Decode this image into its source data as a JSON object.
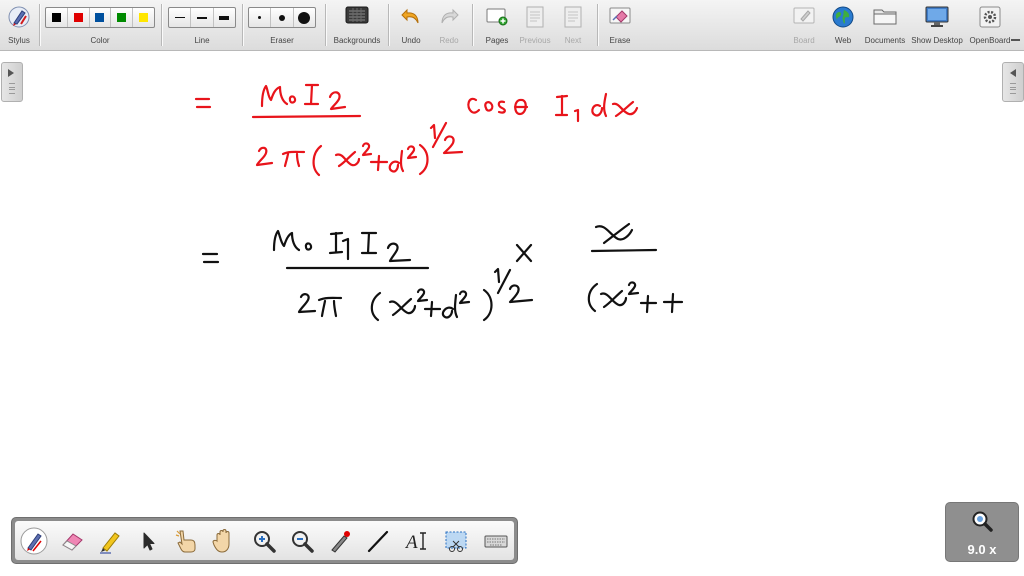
{
  "toolbar": {
    "stylus": "Stylus",
    "color": "Color",
    "line": "Line",
    "eraser": "Eraser",
    "backgrounds": "Backgrounds",
    "undo": "Undo",
    "redo": "Redo",
    "pages": "Pages",
    "previous": "Previous",
    "next": "Next",
    "erase": "Erase",
    "board": "Board",
    "web": "Web",
    "documents": "Documents",
    "show_desktop": "Show Desktop",
    "openboard": "OpenBoard"
  },
  "colors": [
    "#000000",
    "#e00000",
    "#00509e",
    "#008a00",
    "#ffe600"
  ],
  "ink_color": "#e8141b",
  "ink_color_2": "#111111",
  "zoom": {
    "value": "9.0 x"
  },
  "palette_tools": [
    "pen",
    "eraser",
    "marker",
    "selector",
    "pointer",
    "hand",
    "zoom-in",
    "zoom-out",
    "laser",
    "line",
    "text",
    "capture",
    "keyboard"
  ]
}
